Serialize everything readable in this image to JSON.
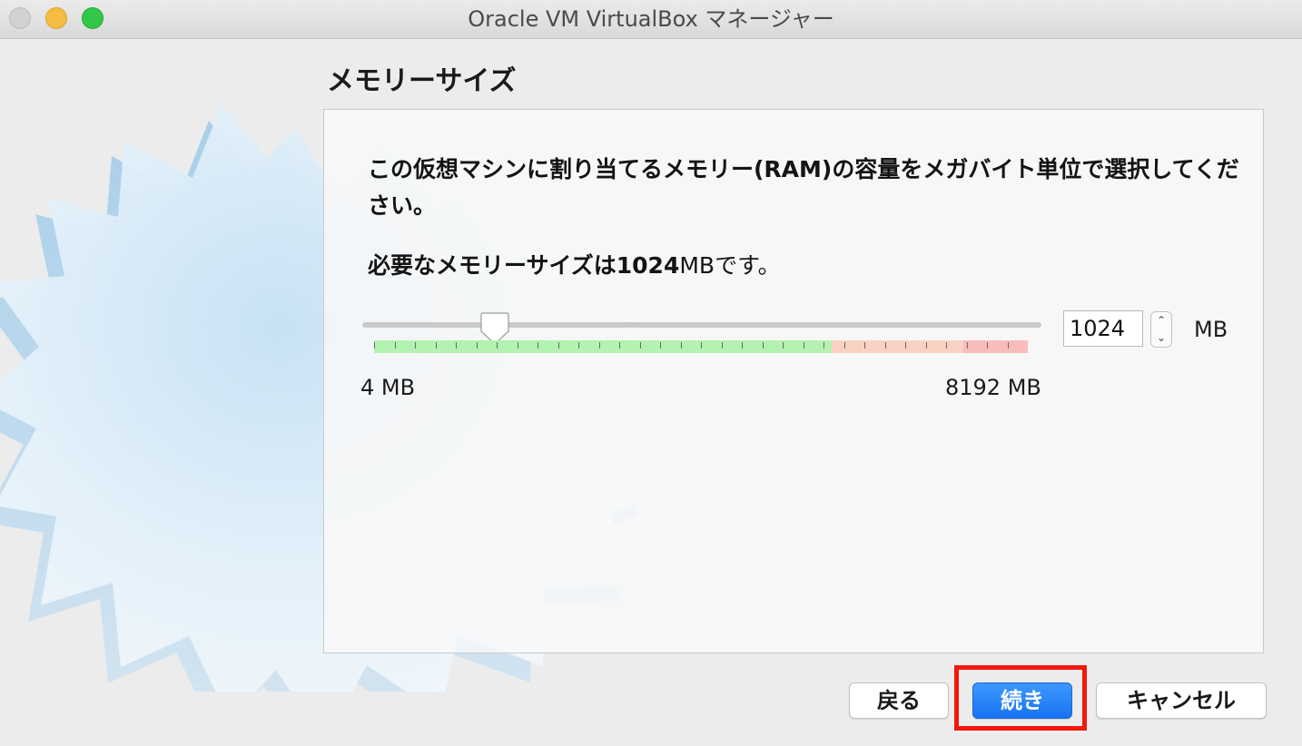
{
  "window": {
    "title": "Oracle VM VirtualBox マネージャー"
  },
  "page": {
    "title": "メモリーサイズ",
    "description": "この仮想マシンに割り当てるメモリー(RAM)の容量をメガバイト単位で選択してください。",
    "recommended_prefix": "必要なメモリーサイズは",
    "recommended_value": "1024",
    "recommended_suffix": "MBです。"
  },
  "memory": {
    "min_label": "4 MB",
    "max_label": "8192 MB",
    "min_mb": 4,
    "max_mb": 8192,
    "value_mb": 1024,
    "input_value": "1024",
    "unit": "MB",
    "zone_colors": {
      "green": "#b4f2b0",
      "orange": "#f9d2c3",
      "red": "#f8bcbc"
    }
  },
  "buttons": {
    "back": "戻る",
    "next": "続き",
    "cancel": "キャンセル"
  },
  "highlight_color": "#f2170c"
}
